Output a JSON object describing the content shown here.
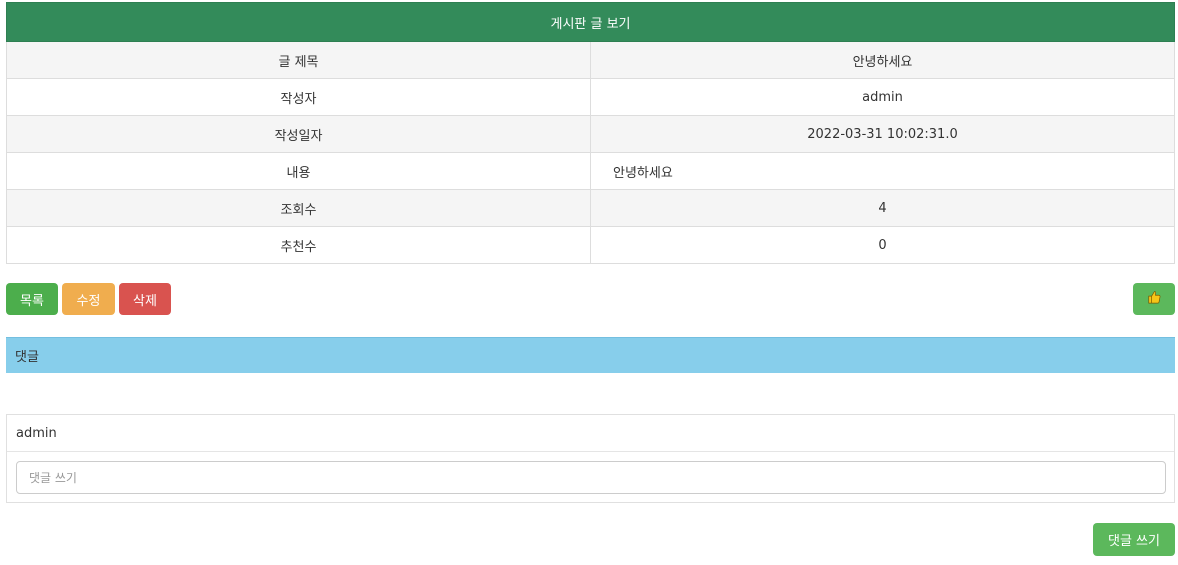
{
  "board": {
    "title": "게시판 글 보기",
    "rows": [
      {
        "label": "글 제목",
        "value": "안녕하세요"
      },
      {
        "label": "작성자",
        "value": "admin"
      },
      {
        "label": "작성일자",
        "value": "2022-03-31 10:02:31.0"
      },
      {
        "label": "내용",
        "value": "안녕하세요"
      },
      {
        "label": "조회수",
        "value": "4"
      },
      {
        "label": "추천수",
        "value": "0"
      }
    ]
  },
  "actions": {
    "list_label": "목록",
    "edit_label": "수정",
    "delete_label": "삭제",
    "like_icon": "thumbs-up-icon"
  },
  "comments": {
    "header": "댓글",
    "user": "admin",
    "input_placeholder": "댓글 쓰기",
    "submit_label": "댓글 쓰기"
  },
  "colors": {
    "header_green": "#338b5a",
    "button_green": "#4cae4c",
    "button_orange": "#f0ad4e",
    "button_red": "#d9534f",
    "comment_header_blue": "#87ceeb",
    "like_icon_yellow": "#f5c518"
  }
}
